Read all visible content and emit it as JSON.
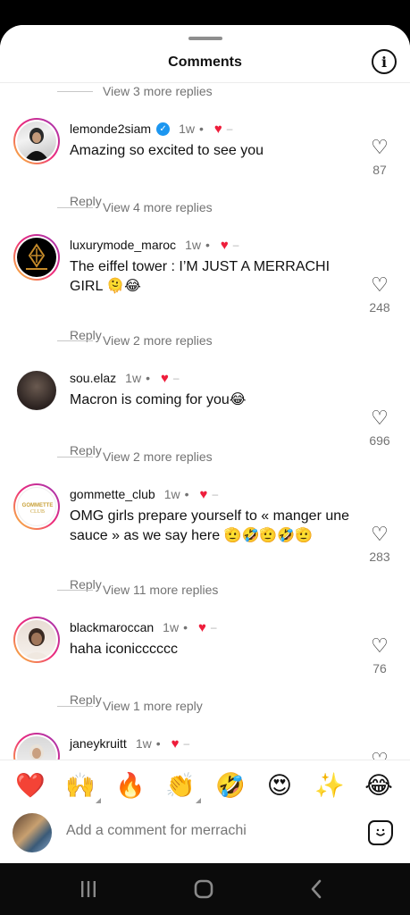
{
  "header": {
    "title": "Comments",
    "info_icon": "info-icon"
  },
  "top_more_replies": "View 3 more replies",
  "comments": [
    {
      "username": "lemonde2siam",
      "verified": true,
      "time": "1w",
      "text": "Amazing so excited to see you",
      "reply": "Reply",
      "likes": "87",
      "more_replies": "View 4 more replies"
    },
    {
      "username": "luxurymode_maroc",
      "verified": false,
      "time": "1w",
      "text": "The eiffel tower : I’M JUST A MERRACHI GIRL 🫠😂",
      "reply": "Reply",
      "likes": "248",
      "more_replies": "View 2 more replies"
    },
    {
      "username": "sou.elaz",
      "verified": false,
      "time": "1w",
      "text": "Macron is coming for you😂",
      "reply": "Reply",
      "likes": "696",
      "more_replies": "View 2 more replies"
    },
    {
      "username": "gommette_club",
      "verified": false,
      "time": "1w",
      "text": "OMG girls prepare yourself to « manger une sauce » as we say here 🫡🤣🫡🤣🫡",
      "reply": "Reply",
      "likes": "283",
      "more_replies": "View 11 more replies"
    },
    {
      "username": "blackmaroccan",
      "verified": false,
      "time": "1w",
      "text": "haha iconicccccc",
      "reply": "Reply",
      "likes": "76",
      "more_replies": "View 1 more reply"
    },
    {
      "username": "janeykruitt",
      "verified": false,
      "time": "1w",
      "text": "",
      "reply": "",
      "likes": "",
      "more_replies": ""
    }
  ],
  "meta_symbols": {
    "dot": "•",
    "dash": "–",
    "heart": "♥",
    "like_outline": "♡",
    "check": "✓"
  },
  "emoji_bar": [
    "❤️",
    "🙌",
    "🔥",
    "👏",
    "🤣",
    "😍",
    "✨",
    "😂"
  ],
  "compose": {
    "placeholder": "Add a comment for merrachi"
  },
  "nav": {
    "recents_icon": "recents-icon",
    "home_icon": "home-icon",
    "back_icon": "back-icon"
  },
  "colors": {
    "heart_red": "#ee1d3b",
    "verified_blue": "#1c96f0",
    "muted_text": "#737373"
  }
}
